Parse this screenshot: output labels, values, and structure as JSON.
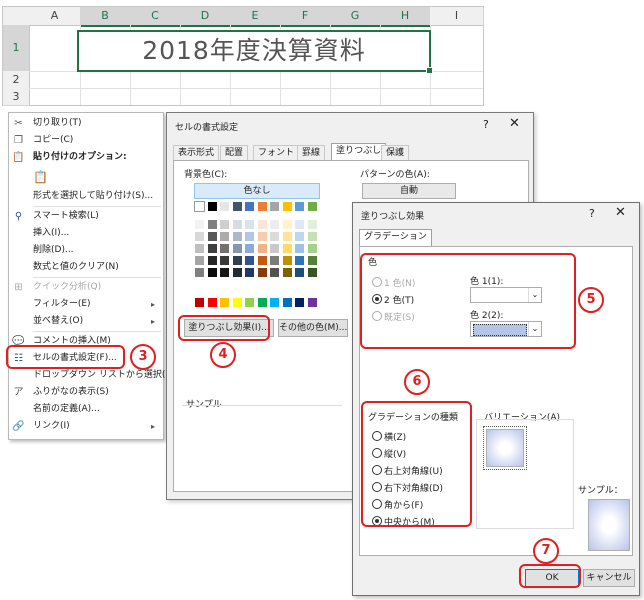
{
  "sheet": {
    "columns": [
      "A",
      "B",
      "C",
      "D",
      "E",
      "F",
      "G",
      "H",
      "I"
    ],
    "rows": [
      "1",
      "2",
      "3"
    ],
    "title_cell": "2018年度決算資料"
  },
  "context_menu": {
    "items": [
      {
        "label": "切り取り(T)",
        "icon": "scissors-icon"
      },
      {
        "label": "コピー(C)",
        "icon": "copy-icon"
      },
      {
        "label": "貼り付けのオプション:",
        "icon": "paste-icon"
      },
      {
        "label": "",
        "icon": "paste-clipboard-icon"
      },
      {
        "label": "形式を選択して貼り付け(S)...",
        "icon": ""
      },
      {
        "label": "スマート検索(L)",
        "icon": "smart-search-icon"
      },
      {
        "label": "挿入(I)...",
        "icon": ""
      },
      {
        "label": "削除(D)...",
        "icon": ""
      },
      {
        "label": "数式と値のクリア(N)",
        "icon": ""
      },
      {
        "label": "クイック分析(Q)",
        "icon": "quick-analysis-icon"
      },
      {
        "label": "フィルター(E)",
        "icon": ""
      },
      {
        "label": "並べ替え(O)",
        "icon": ""
      },
      {
        "label": "コメントの挿入(M)",
        "icon": "comment-icon"
      },
      {
        "label": "セルの書式設定(F)...",
        "icon": "format-cells-icon"
      },
      {
        "label": "ドロップダウン リストから選択(K)...",
        "icon": ""
      },
      {
        "label": "ふりがなの表示(S)",
        "icon": "furigana-icon"
      },
      {
        "label": "名前の定義(A)...",
        "icon": ""
      },
      {
        "label": "リンク(I)",
        "icon": "link-icon"
      }
    ],
    "submenu_arrow": "▸"
  },
  "format_dialog": {
    "title": "セルの書式設定",
    "help": "?",
    "close": "✕",
    "tabs": [
      "表示形式",
      "配置",
      "フォント",
      "罫線",
      "塗りつぶし",
      "保護"
    ],
    "active_tab": "塗りつぶし",
    "bg_color_label": "背景色(C):",
    "no_color": "色なし",
    "pattern_color_label": "パターンの色(A):",
    "pattern_color_value": "自動",
    "fill_effects_button": "塗りつぶし効果(I)...",
    "more_colors_button": "その他の色(M)...",
    "sample_label": "サンプル",
    "colors": {
      "row1": [
        "#ffffff",
        "#000000",
        "#e7e6e6",
        "#44546a",
        "#4472c4",
        "#ed7d31",
        "#a5a5a5",
        "#ffc000",
        "#5b9bd5",
        "#70ad47"
      ],
      "tints": [
        [
          "#f2f2f2",
          "#7f7f7f",
          "#d0cece",
          "#d6dce4",
          "#d9e2f3",
          "#fbe5d5",
          "#ededed",
          "#fff2cc",
          "#deebf6",
          "#e2efd9"
        ],
        [
          "#d8d8d8",
          "#595959",
          "#aeabab",
          "#adb9ca",
          "#b4c6e7",
          "#f7cbac",
          "#dbdbdb",
          "#fee599",
          "#bdd7ee",
          "#c5e0b3"
        ],
        [
          "#bfbfbf",
          "#3f3f3f",
          "#757070",
          "#8496b0",
          "#8eaadb",
          "#f4b183",
          "#c9c9c9",
          "#ffd965",
          "#9cc3e5",
          "#a8d08d"
        ],
        [
          "#a5a5a5",
          "#262626",
          "#3a3838",
          "#323f4f",
          "#2f5496",
          "#c45911",
          "#7b7b7b",
          "#bf9000",
          "#2e75b5",
          "#538135"
        ],
        [
          "#7f7f7f",
          "#0c0c0c",
          "#171616",
          "#222a35",
          "#1f3864",
          "#833c0b",
          "#525252",
          "#7f6000",
          "#1e4e79",
          "#375623"
        ]
      ],
      "standard": [
        "#c00000",
        "#ff0000",
        "#ffc000",
        "#ffff00",
        "#92d050",
        "#00b050",
        "#00b0f0",
        "#0070c0",
        "#002060",
        "#7030a0"
      ]
    }
  },
  "fill_dialog": {
    "title": "塗りつぶし効果",
    "help": "?",
    "close": "✕",
    "tab": "グラデーション",
    "color_group": "色",
    "one_color": "1 色(N)",
    "two_colors": "2 色(T)",
    "preset": "既定(S)",
    "color1_label": "色 1(1):",
    "color2_label": "色 2(2):",
    "shading_group": "グラデーションの種類",
    "shading_styles": [
      "横(Z)",
      "縦(V)",
      "右上対角線(U)",
      "右下対角線(D)",
      "角から(F)",
      "中央から(M)"
    ],
    "selected_style": "中央から(M)",
    "variants_label": "バリエーション(A)",
    "sample_label": "サンプル：",
    "ok": "OK",
    "cancel": "キャンセル",
    "color2_value": "#b4c6e7"
  },
  "annotations": {
    "step3": "3",
    "step4": "4",
    "step5": "5",
    "step6": "6",
    "step7": "7",
    "color": "#e02020"
  }
}
